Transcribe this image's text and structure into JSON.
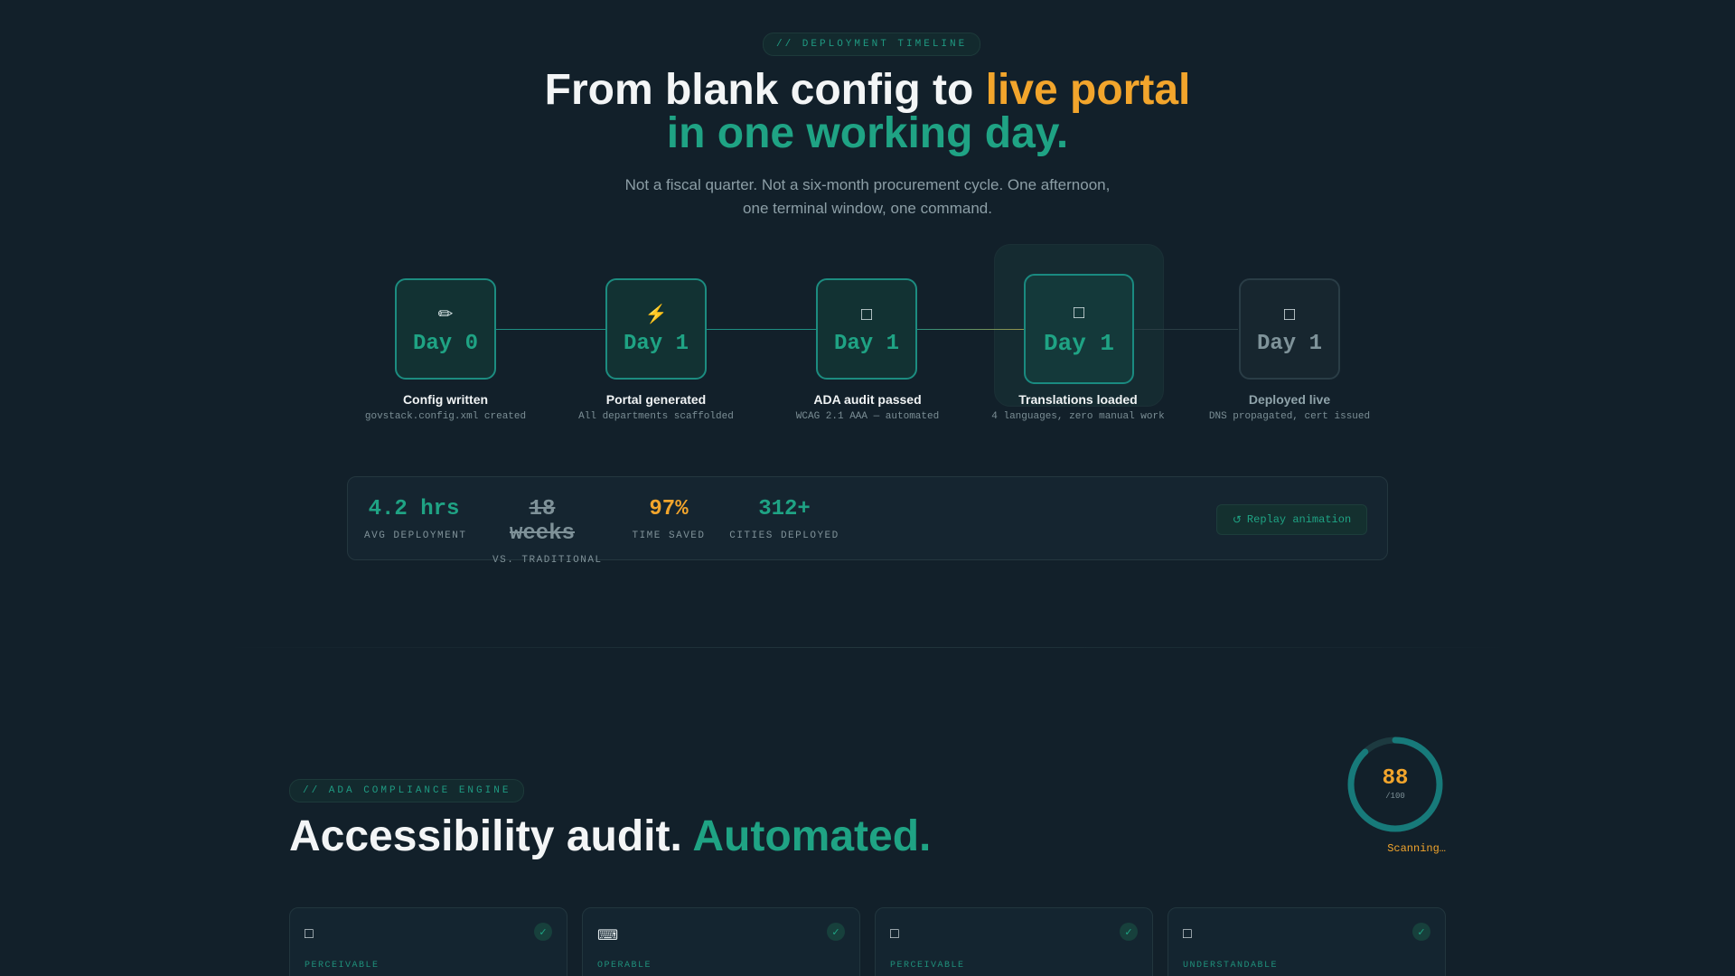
{
  "timeline": {
    "tag": "// DEPLOYMENT TIMELINE",
    "title_part1": "From blank config to ",
    "title_highlight": "live portal",
    "title_line2": "in one working day.",
    "subtitle_line1": "Not a fiscal quarter. Not a six-month procurement cycle. One afternoon,",
    "subtitle_line2": "one terminal window, one command.",
    "steps": [
      {
        "icon": "pencil-icon",
        "glyph": "✏",
        "day": "Day 0",
        "label": "Config written",
        "sub": "govstack.config.xml created"
      },
      {
        "icon": "lightning-icon",
        "glyph": "⚡",
        "day": "Day 1",
        "label": "Portal generated",
        "sub": "All departments scaffolded"
      },
      {
        "icon": "unknown-glyph-icon",
        "glyph": "□",
        "day": "Day 1",
        "label": "ADA audit passed",
        "sub": "WCAG 2.1 AAA — automated"
      },
      {
        "icon": "unknown-glyph-icon",
        "glyph": "□",
        "day": "Day 1",
        "label": "Translations loaded",
        "sub": "4 languages, zero manual work"
      },
      {
        "icon": "unknown-glyph-icon",
        "glyph": "□",
        "day": "Day 1",
        "label": "Deployed live",
        "sub": "DNS propagated, cert issued"
      }
    ]
  },
  "stats": {
    "items": [
      {
        "value": "4.2 hrs",
        "label": "AVG DEPLOYMENT"
      },
      {
        "value": "18 weeks",
        "label": "VS. TRADITIONAL"
      },
      {
        "value": "97%",
        "label": "TIME SAVED"
      },
      {
        "value": "312+",
        "label": "CITIES DEPLOYED"
      }
    ],
    "replay_icon": "↺",
    "replay_label": "Replay animation"
  },
  "ada": {
    "tag": "// ADA COMPLIANCE ENGINE",
    "title_part1": "Accessibility audit. ",
    "title_highlight": "Automated.",
    "score": "88",
    "score_max": "/100",
    "score_fraction": 0.88,
    "scanning": "Scanning…",
    "cards": [
      {
        "icon": "unknown-glyph-icon",
        "glyph": "□",
        "category": "PERCEIVABLE",
        "check": "✓"
      },
      {
        "icon": "keyboard-icon",
        "glyph": "⌨",
        "category": "OPERABLE",
        "check": "✓"
      },
      {
        "icon": "unknown-glyph-icon",
        "glyph": "□",
        "category": "PERCEIVABLE",
        "check": "✓"
      },
      {
        "icon": "unknown-glyph-icon",
        "glyph": "□",
        "category": "UNDERSTANDABLE",
        "check": "✓"
      }
    ]
  },
  "colors": {
    "background": "#12202a",
    "teal": "#1fa384",
    "orange": "#f2a52c"
  }
}
